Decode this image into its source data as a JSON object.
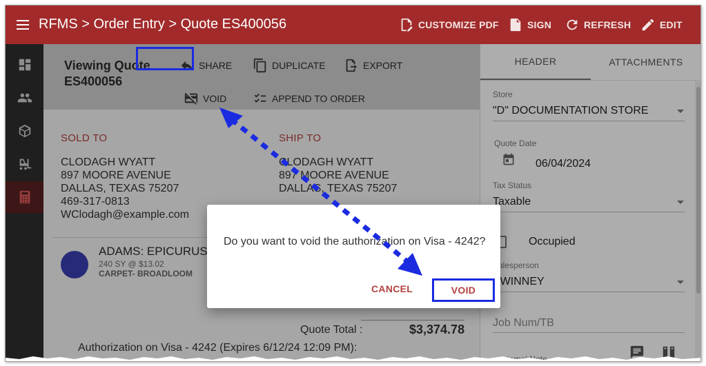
{
  "topbar": {
    "breadcrumb": "RFMS > Order Entry > Quote ES400056",
    "actions": [
      {
        "label": "CUSTOMIZE PDF",
        "icon": "pdf-edit-icon"
      },
      {
        "label": "SIGN",
        "icon": "pdf-sign-icon"
      },
      {
        "label": "REFRESH",
        "icon": "refresh-icon"
      },
      {
        "label": "EDIT",
        "icon": "pencil-icon"
      }
    ]
  },
  "sidenav": {
    "items": [
      {
        "name": "dashboard",
        "icon": "dashboard-icon"
      },
      {
        "name": "customers",
        "icon": "people-icon"
      },
      {
        "name": "products",
        "icon": "cube-icon"
      },
      {
        "name": "warehouse",
        "icon": "forklift-icon"
      },
      {
        "name": "calculator",
        "icon": "calculator-icon",
        "active": true
      }
    ]
  },
  "header": {
    "title": "Viewing Quote ES400056",
    "actions": {
      "share": "SHARE",
      "duplicate": "DUPLICATE",
      "export": "EXPORT",
      "void": "VOID",
      "append": "APPEND TO ORDER"
    }
  },
  "sold_to": {
    "label": "SOLD TO",
    "name": "CLODAGH WYATT",
    "street": "897 MOORE AVENUE",
    "city": "DALLAS, TEXAS 75207",
    "phone": "469-317-0813",
    "email": "WClodagh@example.com"
  },
  "ship_to": {
    "label": "SHIP TO",
    "name": "CLODAGH WYATT",
    "street": "897 MOORE AVENUE",
    "city": "DALLAS, TEXAS 75207"
  },
  "line_item": {
    "name": "ADAMS: EPICURUS",
    "detail": "240 SY @ $13.02",
    "category": "CARPET- BROADLOOM"
  },
  "totals": {
    "label": "Quote Total :",
    "value": "$3,374.78",
    "authorization": "Authorization on Visa - 4242 (Expires 6/12/24 12:09 PM):"
  },
  "right_panel": {
    "tabs": [
      "HEADER",
      "ATTACHMENTS"
    ],
    "store_label": "Store",
    "store_value": "\"D\" DOCUMENTATION STORE",
    "quote_date_label": "Quote Date",
    "quote_date_value": "06/04/2024",
    "tax_status_label": "Tax Status",
    "tax_status_value": "Taxable",
    "occupied_label": "Occupied",
    "salesperson_label": "Salesperson",
    "salesperson_value": "SWINNEY",
    "job_placeholder": "Job Num/TB",
    "internal_note_label": "Internal Note"
  },
  "dialog": {
    "message": "Do you want to void the authorization on Visa - 4242?",
    "cancel": "CANCEL",
    "confirm": "VOID"
  },
  "colors": {
    "brand": "#a22a2a",
    "highlight": "#1a2be0",
    "accent_text": "#b2403e"
  }
}
